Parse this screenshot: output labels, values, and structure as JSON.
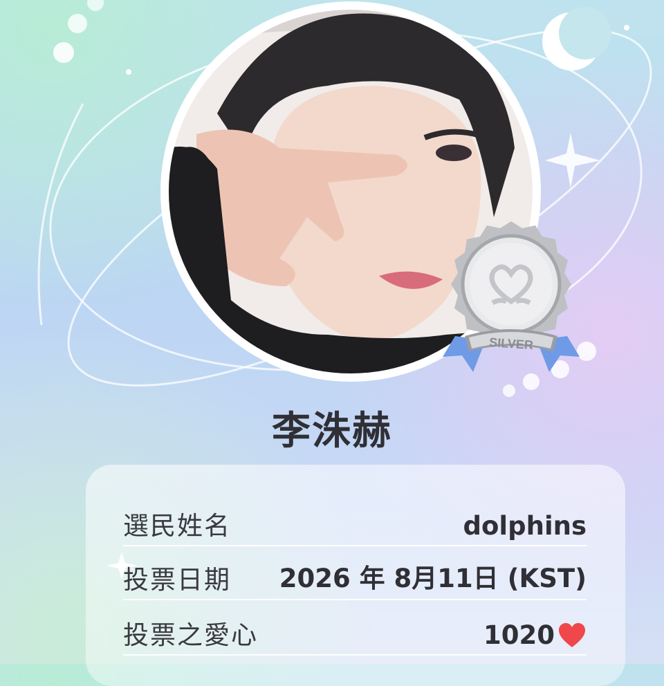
{
  "profile": {
    "name": "李洙赫",
    "badge_label": "SILVER"
  },
  "vote_info": {
    "rows": [
      {
        "label": "選民姓名",
        "value": "dolphins"
      },
      {
        "label": "投票日期",
        "value": "2026 年 8月11日 (KST)"
      },
      {
        "label": "投票之愛心",
        "value": "1020"
      }
    ]
  },
  "icons": {
    "heart": "heart-icon",
    "moon": "crescent-moon-icon",
    "sparkle": "sparkle-icon"
  },
  "colors": {
    "heart": "#f0474b",
    "badge_silver": "#c9cace",
    "ribbon": "#6f9ae6"
  }
}
